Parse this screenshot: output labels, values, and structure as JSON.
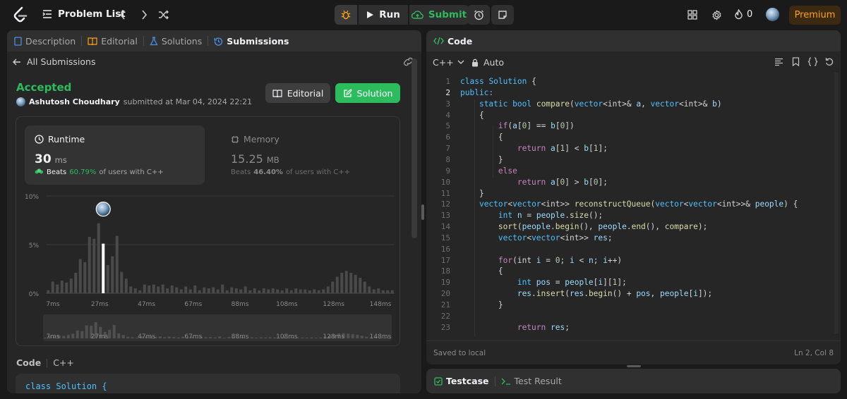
{
  "topbar": {
    "problem_list": "Problem List",
    "run": "Run",
    "submit": "Submit",
    "streak": "0",
    "premium": "Premium"
  },
  "left_tabs": [
    {
      "label": "Description"
    },
    {
      "label": "Editorial"
    },
    {
      "label": "Solutions"
    },
    {
      "label": "Submissions"
    }
  ],
  "submission": {
    "back_label": "All Submissions",
    "status": "Accepted",
    "user": "Ashutosh Choudhary",
    "submitted_text": "submitted at Mar 04, 2024 22:21",
    "editorial_btn": "Editorial",
    "solution_btn": "Solution",
    "runtime": {
      "title": "Runtime",
      "value": "30",
      "unit": "ms",
      "beats_prefix": "Beats",
      "beats_pct": "60.79%",
      "beats_suffix": "of users with C++"
    },
    "memory": {
      "title": "Memory",
      "value": "15.25",
      "unit": "MB",
      "beats_prefix": "Beats",
      "beats_pct": "46.40%",
      "beats_suffix": "of users with C++"
    },
    "code_label": "Code",
    "code_lang": "C++",
    "code_preview": "class Solution {"
  },
  "chart_data": {
    "type": "bar",
    "y_ticks": [
      "10%",
      "5%",
      "0%"
    ],
    "ylim": [
      0,
      10
    ],
    "x_tick_labels": [
      "7ms",
      "27ms",
      "47ms",
      "67ms",
      "88ms",
      "108ms",
      "128ms",
      "148ms"
    ],
    "values": [
      0.3,
      1.2,
      0.9,
      1.3,
      1.1,
      1.5,
      2.1,
      3.5,
      3.2,
      5.8,
      5.6,
      7.2,
      5.1,
      2.9,
      3.8,
      5.9,
      2.2,
      1.5,
      0.7,
      0.5,
      0.3,
      0.9,
      0.8,
      0.9,
      0.7,
      0.9,
      0.5,
      0.8,
      0.6,
      0.4,
      0.7,
      0.4,
      0.8,
      0.3,
      0.6,
      0.5,
      0.6,
      0.4,
      0.9,
      0.3,
      0.6,
      0.5,
      0.4,
      0.7,
      0.3,
      0.5,
      0.3,
      0.5,
      0.4,
      0.5,
      0.4,
      0.3,
      0.5,
      0.3,
      0.5,
      0.4,
      0.4,
      0.3,
      0.4,
      0.3,
      0.4,
      0.7,
      1.2,
      1.7,
      2.1,
      2.3,
      2.1,
      1.9,
      1.6,
      1.2,
      0.7,
      0.4,
      0.5,
      0.3,
      0.3,
      0.3
    ],
    "highlight_index": 12,
    "highlight_value": 7.2
  },
  "editor": {
    "title": "Code",
    "lang": "C++",
    "mode": "Auto",
    "status_left": "Saved to local",
    "status_right": "Ln 2, Col 8",
    "lines": [
      "class Solution {",
      "public:",
      "    static bool compare(vector<int>& a, vector<int>& b)",
      "    {",
      "        if(a[0] == b[0])",
      "        {",
      "            return a[1] < b[1];",
      "        }",
      "        else",
      "            return a[0] > b[0];",
      "    }",
      "    vector<vector<int>> reconstructQueue(vector<vector<int>>& people) {",
      "        int n = people.size();",
      "        sort(people.begin(), people.end(), compare);",
      "        vector<vector<int>> res;",
      "",
      "        for(int i = 0; i < n; i++)",
      "        {",
      "            int pos = people[i][1];",
      "            res.insert(res.begin() + pos, people[i]);",
      "        }",
      "",
      "            return res;"
    ]
  },
  "bottom_tabs": [
    {
      "label": "Testcase"
    },
    {
      "label": "Test Result"
    }
  ]
}
